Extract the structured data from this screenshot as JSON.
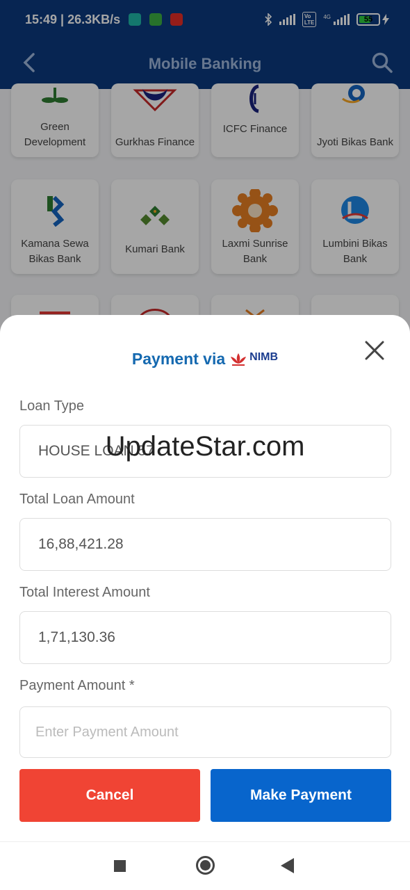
{
  "status_bar": {
    "time_speed": "15:49 | 26.3KB/s",
    "battery": "55",
    "volte": "Vo LTE",
    "net": "4G"
  },
  "app_bar": {
    "title": "Mobile Banking"
  },
  "banks": [
    {
      "name": "Green Development"
    },
    {
      "name": "Gurkhas Finance"
    },
    {
      "name": "ICFC Finance"
    },
    {
      "name": "Jyoti Bikas Bank"
    },
    {
      "name": "Kamana Sewa Bikas Bank"
    },
    {
      "name": "Kumari Bank"
    },
    {
      "name": "Laxmi Sunrise Bank"
    },
    {
      "name": "Lumbini Bikas Bank"
    }
  ],
  "sheet": {
    "title": "Payment via",
    "brand": "NIMB",
    "fields": {
      "loan_type_label": "Loan Type",
      "loan_type_value": "HOUSE LOAN 57",
      "total_loan_label": "Total Loan Amount",
      "total_loan_value": "16,88,421.28",
      "total_interest_label": "Total Interest Amount",
      "total_interest_value": "1,71,130.36",
      "payment_amount_label": "Payment Amount *",
      "payment_amount_placeholder": "Enter Payment Amount"
    },
    "cancel_label": "Cancel",
    "pay_label": "Make Payment"
  },
  "watermark": "UpdateStar.com",
  "colors": {
    "primary": "#0b3a7e",
    "accent_blue": "#0865cc",
    "cancel_red": "#f04434",
    "title_blue": "#1569b0"
  }
}
